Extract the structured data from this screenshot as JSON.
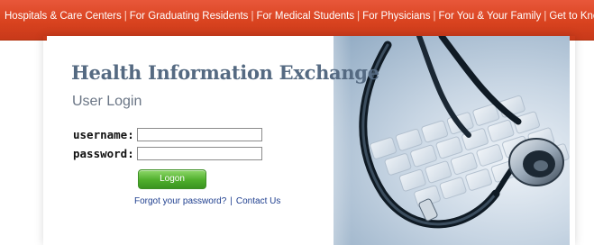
{
  "topnav": {
    "items": [
      {
        "label": "Hospitals & Care Centers"
      },
      {
        "label": "For Graduating Residents"
      },
      {
        "label": "For Medical Students"
      },
      {
        "label": "For Physicians"
      },
      {
        "label": "For You & Your Family"
      },
      {
        "label": "Get to Know Us"
      }
    ],
    "separator": "|"
  },
  "login": {
    "app_title": "Health Information Exchange",
    "heading": "User Login",
    "username_label": "username:",
    "username_value": "",
    "password_label": "password:",
    "password_value": "",
    "logon_label": "Logon",
    "forgot_label": "Forgot your password?",
    "footer_separator": "|",
    "contact_label": "Contact Us"
  },
  "colors": {
    "nav_bar": "#d9431f",
    "title": "#556a82",
    "logon_button": "#4fae2c",
    "link": "#1f3f8f"
  }
}
